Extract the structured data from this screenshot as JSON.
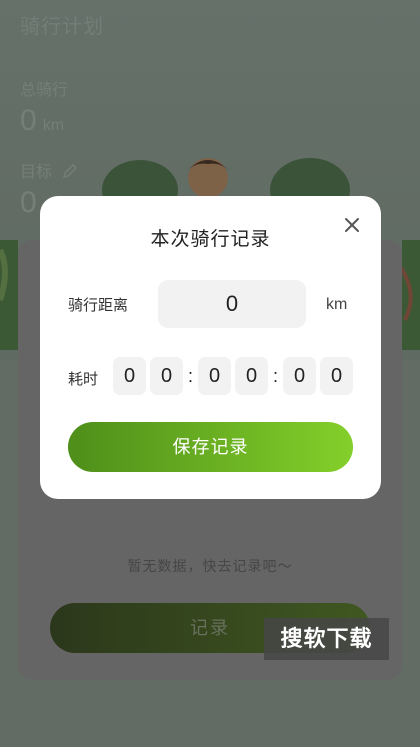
{
  "header": {
    "title": "骑行计划"
  },
  "stats": {
    "total_label": "总骑行",
    "total_value": "0",
    "total_unit": "km",
    "goal_label": "目标",
    "goal_value": "0"
  },
  "main": {
    "empty_text": "暂无数据，快去记录吧～",
    "record_button": "记录"
  },
  "modal": {
    "title": "本次骑行记录",
    "distance_label": "骑行距离",
    "distance_value": "0",
    "distance_unit": "km",
    "time_label": "耗时",
    "time_digits": [
      "0",
      "0",
      "0",
      "0",
      "0",
      "0"
    ],
    "time_separator": ":",
    "save_button": "保存记录"
  },
  "watermark": "搜软下载",
  "colors": {
    "accent_start": "#4e8e1a",
    "accent_end": "#84cf2a"
  }
}
